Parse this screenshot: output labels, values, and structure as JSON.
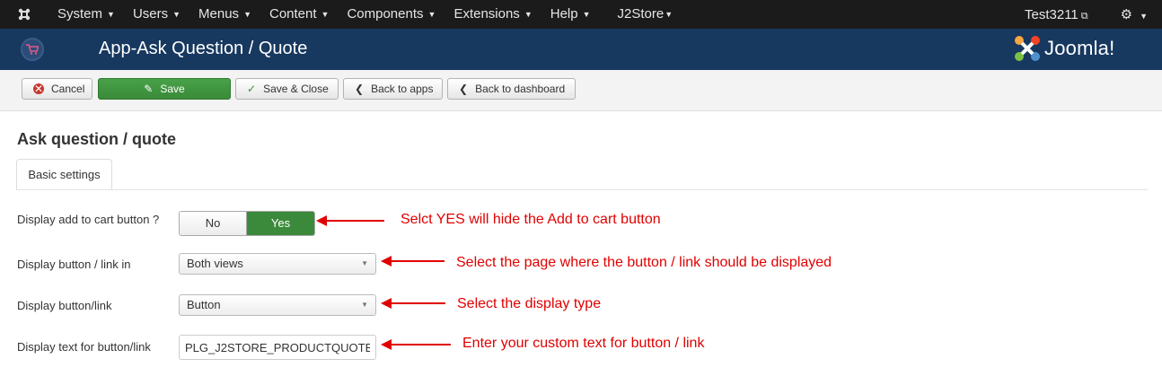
{
  "topnav": {
    "logo_icon": "joomla-icon",
    "menu": [
      {
        "label": "System"
      },
      {
        "label": "Users"
      },
      {
        "label": "Menus"
      },
      {
        "label": "Content"
      },
      {
        "label": "Components"
      },
      {
        "label": "Extensions"
      },
      {
        "label": "Help"
      },
      {
        "label": "J2Store"
      }
    ],
    "user": "Test3211",
    "settings_icon": "gear-icon"
  },
  "header": {
    "title": "App-Ask Question / Quote",
    "brand": "Joomla!",
    "colors": {
      "nav": "#1b1b1b",
      "header": "#17385f"
    }
  },
  "toolbar": {
    "cancel": "Cancel",
    "save": "Save",
    "save_close": "Save & Close",
    "back_apps": "Back to apps",
    "back_dashboard": "Back to dashboard",
    "colors": {
      "save": "#46a546",
      "cancel_icon": "#c6382f"
    }
  },
  "main": {
    "heading": "Ask question / quote",
    "tab": "Basic settings",
    "fields": {
      "add_to_cart": {
        "label": "Display add to cart button ?",
        "options": [
          "No",
          "Yes"
        ],
        "selected": "Yes"
      },
      "button_link_in": {
        "label": "Display button / link in",
        "value": "Both views"
      },
      "button_link": {
        "label": "Display button/link",
        "value": "Button"
      },
      "text": {
        "label": "Display text for button/link",
        "value": "PLG_J2STORE_PRODUCTQUOTE"
      }
    }
  },
  "annotations": {
    "a1": "Selct YES will hide the Add to cart button",
    "a2": "Select the page where the button / link should be displayed",
    "a3": "Select the display type",
    "a4": "Enter your custom text for button / link",
    "color": "#e00000"
  }
}
